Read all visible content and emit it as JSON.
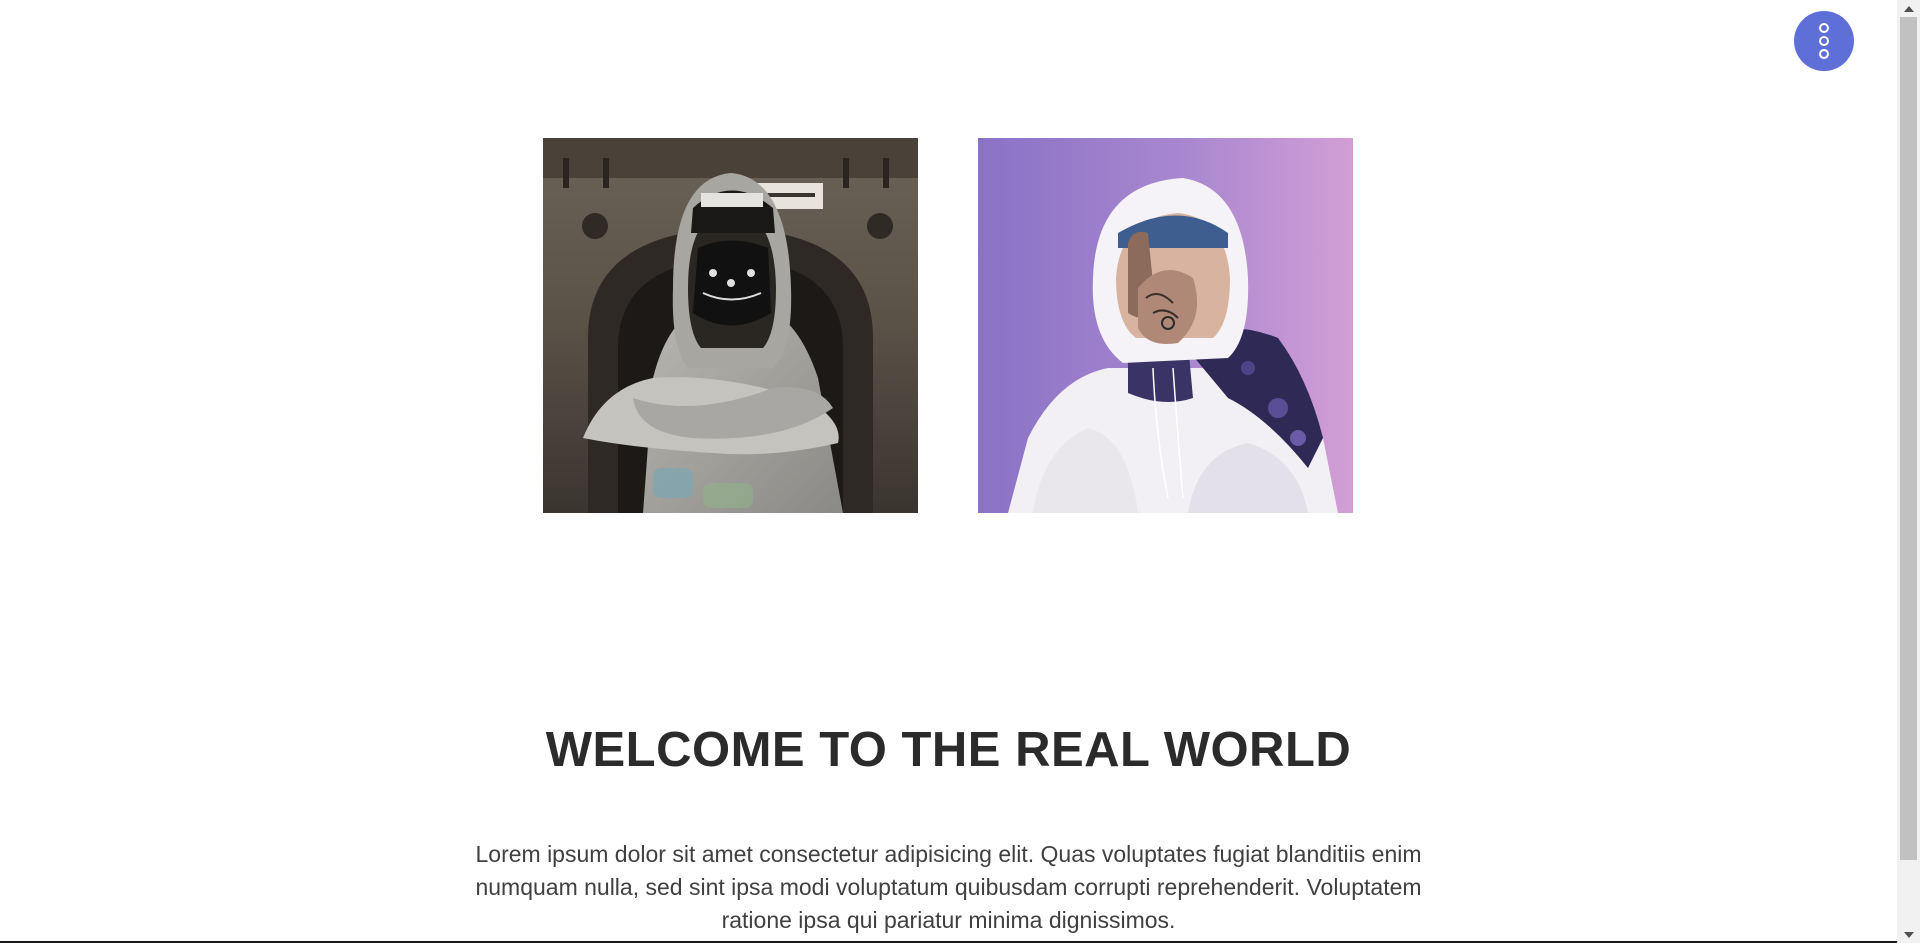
{
  "menu_button": {
    "icon": "vertical-dots-icon",
    "color": "#5f6fd8"
  },
  "photos": [
    {
      "name": "masked-man-grey-hoodie-photo"
    },
    {
      "name": "tattooed-man-white-hoodie-purple-photo"
    }
  ],
  "welcome": {
    "title": "WELCOME TO THE REAL WORLD",
    "text": "Lorem ipsum dolor sit amet consectetur adipisicing elit. Quas voluptates fugiat blanditiis enim numquam nulla, sed sint ipsa modi voluptatum quibusdam corrupti reprehenderit. Voluptatem ratione ipsa qui pariatur minima dignissimos."
  },
  "colors": {
    "accent": "#5f6fd8",
    "heading": "#2b2b2b",
    "body_text": "#404040"
  }
}
